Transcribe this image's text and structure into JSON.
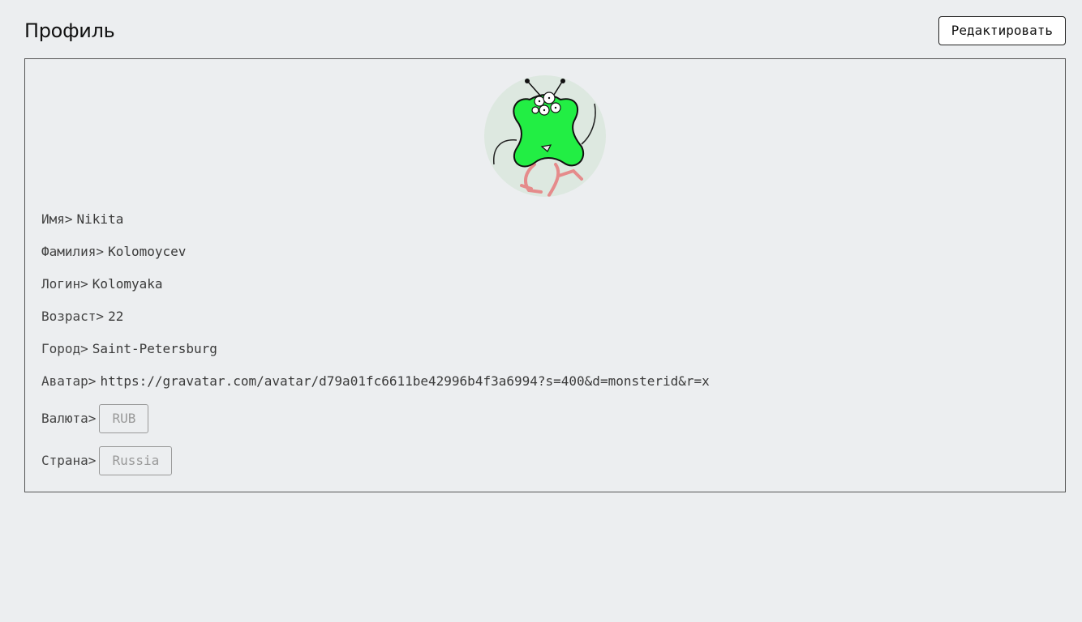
{
  "header": {
    "title": "Профиль",
    "edit_label": "Редактировать"
  },
  "profile": {
    "avatar_icon": "monster-avatar-icon",
    "fields": {
      "first_name": {
        "label": "Имя>",
        "value": "Nikita"
      },
      "last_name": {
        "label": "Фамилия>",
        "value": "Kolomoycev"
      },
      "login": {
        "label": "Логин>",
        "value": "Kolomyaka"
      },
      "age": {
        "label": "Возраст>",
        "value": "22"
      },
      "city": {
        "label": "Город>",
        "value": "Saint-Petersburg"
      },
      "avatar_url": {
        "label": "Аватар>",
        "value": "https://gravatar.com/avatar/d79a01fc6611be42996b4f3a6994?s=400&d=monsterid&r=x"
      },
      "currency": {
        "label": "Валюта>",
        "value": "RUB"
      },
      "country": {
        "label": "Страна>",
        "value": "Russia"
      }
    }
  },
  "colors": {
    "background": "#eceef0",
    "monster_body": "#22ee44",
    "monster_legs": "#f0a0a0"
  }
}
